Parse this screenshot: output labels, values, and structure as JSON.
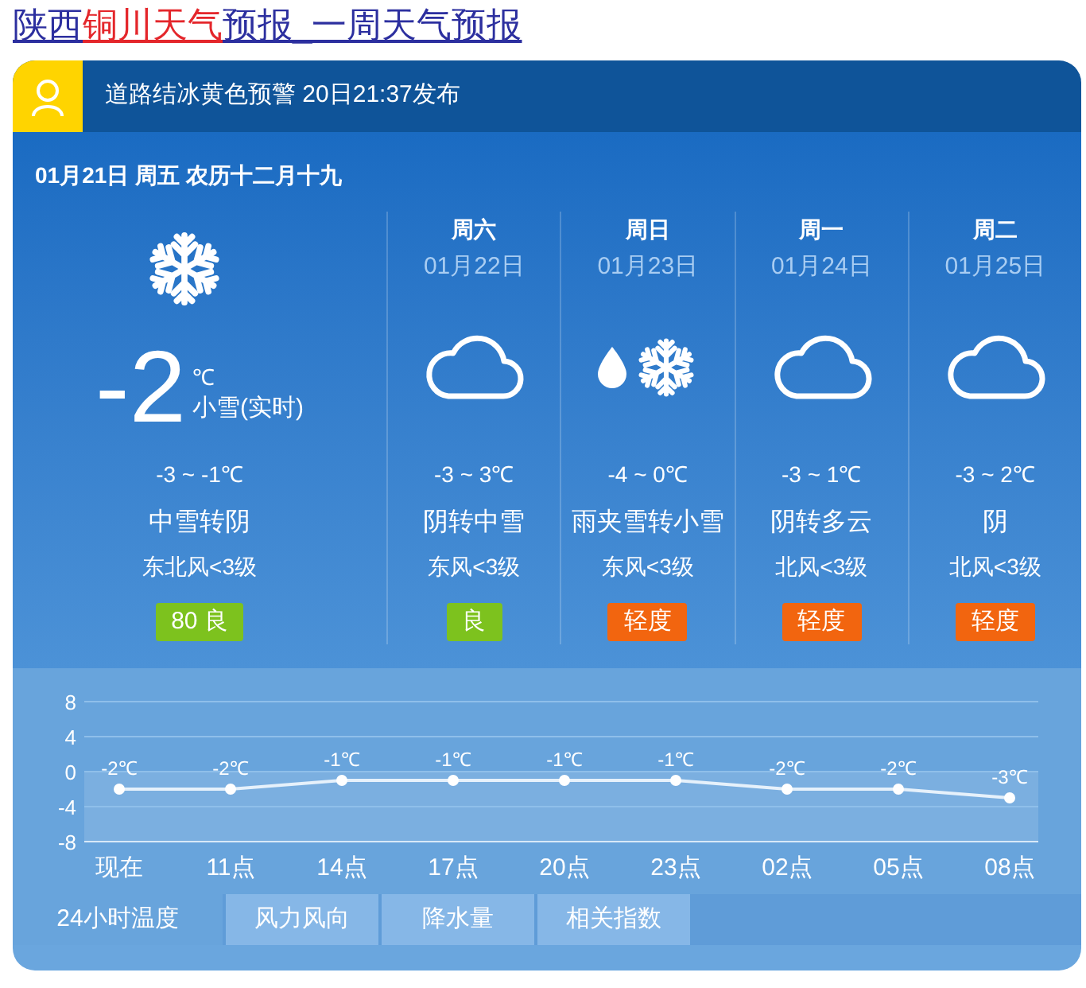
{
  "title": {
    "parts": [
      {
        "text": "陕西",
        "highlighted": false
      },
      {
        "text": "铜川天气",
        "highlighted": true
      },
      {
        "text": "预报_一周天气预报",
        "highlighted": false
      }
    ]
  },
  "alert": {
    "text": "道路结冰黄色预警 20日21:37发布"
  },
  "today": {
    "date": "01月21日 周五 农历十二月十九",
    "kind": "snow",
    "temp": "-2",
    "unit": "℃",
    "condition": "小雪(实时)",
    "range": "-3 ~ -1℃",
    "weather": "中雪转阴",
    "wind": "东北风<3级",
    "aqi": {
      "text": "80 良",
      "color": "#7dc21e"
    }
  },
  "days": [
    {
      "weekday": "周六",
      "date": "01月22日",
      "kind": "cloudy",
      "range": "-3 ~ 3℃",
      "weather": "阴转中雪",
      "wind": "东风<3级",
      "aqi": {
        "text": "良",
        "color": "#7dc21e"
      }
    },
    {
      "weekday": "周日",
      "date": "01月23日",
      "kind": "sleet",
      "range": "-4 ~ 0℃",
      "weather": "雨夹雪转小雪",
      "wind": "东风<3级",
      "aqi": {
        "text": "轻度",
        "color": "#f2650f"
      }
    },
    {
      "weekday": "周一",
      "date": "01月24日",
      "kind": "cloudy",
      "range": "-3 ~ 1℃",
      "weather": "阴转多云",
      "wind": "北风<3级",
      "aqi": {
        "text": "轻度",
        "color": "#f2650f"
      }
    },
    {
      "weekday": "周二",
      "date": "01月25日",
      "kind": "cloudy",
      "range": "-3 ~ 2℃",
      "weather": "阴",
      "wind": "北风<3级",
      "aqi": {
        "text": "轻度",
        "color": "#f2650f"
      }
    }
  ],
  "hourly": {
    "chart_data": {
      "type": "line",
      "categories": [
        "现在",
        "11点",
        "14点",
        "17点",
        "20点",
        "23点",
        "02点",
        "05点",
        "08点"
      ],
      "series": [
        {
          "color": "#e6f1fb",
          "marker": "circle",
          "values": [
            -2,
            -2,
            -1,
            -1,
            -1,
            -1,
            -2,
            -2,
            -3
          ]
        }
      ],
      "ylim": [
        -8,
        8
      ],
      "yticks": [
        -8,
        -4,
        0,
        4,
        8
      ],
      "grid": true,
      "bands": [
        {
          "axis": "y",
          "from": -8,
          "to": 0
        }
      ],
      "value_labels": [
        "-2℃",
        "-2℃",
        "-1℃",
        "-1℃",
        "-1℃",
        "-1℃",
        "-2℃",
        "-2℃",
        "-3℃"
      ]
    }
  },
  "tabs": [
    {
      "label": "24小时温度",
      "selected": true
    },
    {
      "label": "风力风向",
      "selected": false
    },
    {
      "label": "降水量",
      "selected": false
    },
    {
      "label": "相关指数",
      "selected": false
    }
  ]
}
